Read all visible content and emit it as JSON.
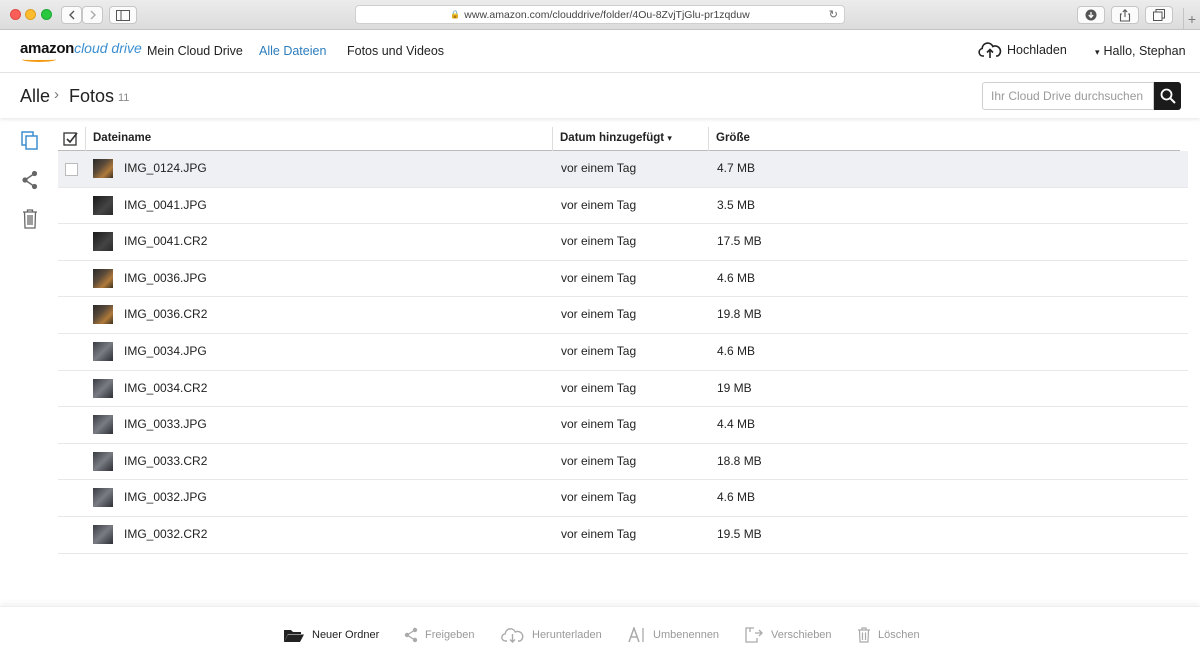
{
  "browser": {
    "url": "www.amazon.com/clouddrive/folder/4Ou-8ZvjTjGlu-pr1zqduw",
    "lock_icon": "lock-icon",
    "reload_icon": "reload-icon",
    "new_tab_label": "+"
  },
  "header": {
    "logo_word": "amazon",
    "logo_product": "cloud drive",
    "nav": [
      "Mein Cloud Drive",
      "Alle Dateien",
      "Fotos und Videos"
    ],
    "active_nav": "Alle Dateien",
    "upload_label": "Hochladen",
    "user_caret": "▾",
    "user_label": "Hallo, Stephan"
  },
  "breadcrumb": {
    "root": "Alle",
    "separator": "›",
    "current": "Fotos",
    "count": "11"
  },
  "search": {
    "placeholder": "Ihr Cloud Drive durchsuchen"
  },
  "table": {
    "columns": {
      "name": "Dateiname",
      "date": "Datum hinzugefügt",
      "sort_indicator": "▾",
      "size": "Größe"
    },
    "rows": [
      {
        "name": "IMG_0124.JPG",
        "date": "vor einem Tag",
        "size": "4.7 MB"
      },
      {
        "name": "IMG_0041.JPG",
        "date": "vor einem Tag",
        "size": "3.5 MB"
      },
      {
        "name": "IMG_0041.CR2",
        "date": "vor einem Tag",
        "size": "17.5 MB"
      },
      {
        "name": "IMG_0036.JPG",
        "date": "vor einem Tag",
        "size": "4.6 MB"
      },
      {
        "name": "IMG_0036.CR2",
        "date": "vor einem Tag",
        "size": "19.8 MB"
      },
      {
        "name": "IMG_0034.JPG",
        "date": "vor einem Tag",
        "size": "4.6 MB"
      },
      {
        "name": "IMG_0034.CR2",
        "date": "vor einem Tag",
        "size": "19 MB"
      },
      {
        "name": "IMG_0033.JPG",
        "date": "vor einem Tag",
        "size": "4.4 MB"
      },
      {
        "name": "IMG_0033.CR2",
        "date": "vor einem Tag",
        "size": "18.8 MB"
      },
      {
        "name": "IMG_0032.JPG",
        "date": "vor einem Tag",
        "size": "4.6 MB"
      },
      {
        "name": "IMG_0032.CR2",
        "date": "vor einem Tag",
        "size": "19.5 MB"
      }
    ]
  },
  "toolbar": {
    "new_folder": "Neuer Ordner",
    "share": "Freigeben",
    "download": "Herunterladen",
    "rename": "Umbenennen",
    "move": "Verschieben",
    "delete": "Löschen"
  },
  "colors": {
    "accent": "#2d7dbd",
    "search_button": "#1b1b1b",
    "selected_row": "#eef0f3"
  }
}
